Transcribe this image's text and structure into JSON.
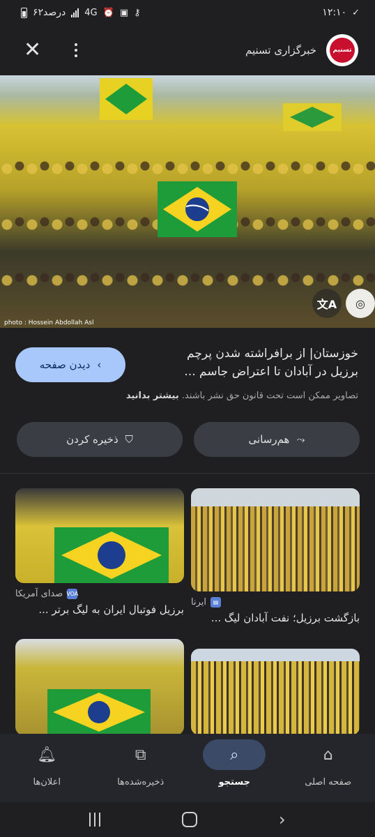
{
  "status_bar": {
    "time": "۱۲:۱۰",
    "battery": "۶۲درصد",
    "network": "4G"
  },
  "header": {
    "source_name": "خبرگزاری تسنیم",
    "logo_text": "تسنیم"
  },
  "hero": {
    "photo_credit": "photo : Hossein Abdollah Asl"
  },
  "result": {
    "title": "خوزستان| از برافراشته شدن پرچم برزیل در آبادان تا اعتراض جاسم ...",
    "visit_label": "دیدن صفحه",
    "copyright_text": "تصاویر ممکن است تحت قانون حق نشر باشند.",
    "learn_more": "بیشتر بدانید",
    "share_label": "هم‌رسانی",
    "save_label": "ذخیره کردن"
  },
  "related": [
    {
      "source": "ایرنا",
      "title": "بازگشت برزیل؛ نفت آبادان لیگ ..."
    },
    {
      "source": "صدای آمریکا",
      "title": "برزیل فوتبال ایران به لیگ برتر ..."
    }
  ],
  "bottom_nav": {
    "home": "صفحه اصلی",
    "search": "جستجو",
    "saved": "ذخیره‌شده‌ها",
    "notifications": "اعلان‌ها"
  }
}
